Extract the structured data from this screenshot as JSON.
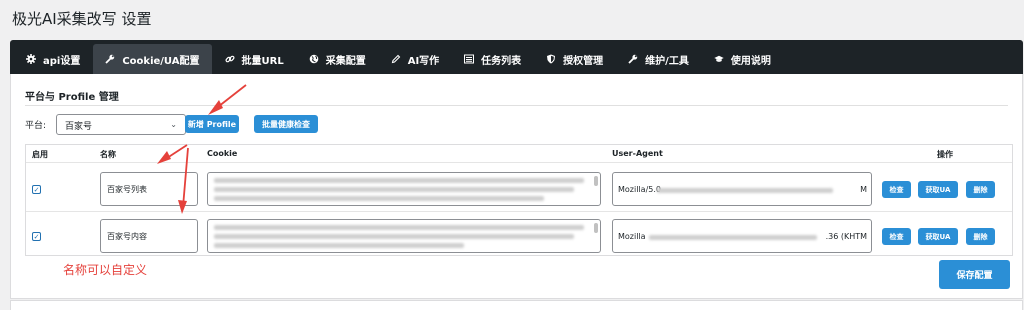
{
  "page": {
    "title": "极光AI采集改写 设置"
  },
  "tabs": [
    {
      "label": "api设置",
      "icon": "gear-icon",
      "active": false
    },
    {
      "label": "Cookie/UA配置",
      "icon": "wrench-icon",
      "active": true
    },
    {
      "label": "批量URL",
      "icon": "link-icon",
      "active": false
    },
    {
      "label": "采集配置",
      "icon": "globe-icon",
      "active": false
    },
    {
      "label": "AI写作",
      "icon": "pen-icon",
      "active": false
    },
    {
      "label": "任务列表",
      "icon": "list-icon",
      "active": false
    },
    {
      "label": "授权管理",
      "icon": "shield-icon",
      "active": false
    },
    {
      "label": "维护/工具",
      "icon": "wrench-icon",
      "active": false
    },
    {
      "label": "使用说明",
      "icon": "graduation-cap-icon",
      "active": false
    }
  ],
  "section": {
    "title": "平台与 Profile 管理",
    "platform_label": "平台:",
    "platform_value": "百家号",
    "add_profile": "新增 Profile",
    "batch_check": "批量健康检查"
  },
  "table": {
    "headers": {
      "enabled": "启用",
      "name": "名称",
      "cookie": "Cookie",
      "ua": "User-Agent",
      "actions": "操作"
    },
    "rows": [
      {
        "enabled": true,
        "name": "百家号列表",
        "ua_prefix": "Mozilla/5.0",
        "ua_suffix": "M"
      },
      {
        "enabled": true,
        "name": "百家号内容",
        "ua_prefix": "Mozilla",
        "ua_suffix": ".36 (KHTM"
      }
    ],
    "actions": {
      "check": "检查",
      "get_ua": "获取UA",
      "delete": "删除"
    }
  },
  "annotation": {
    "note": "名称可以自定义",
    "color": "#e5413b"
  },
  "footer": {
    "save": "保存配置"
  },
  "colors": {
    "tabbar": "#1d2327",
    "accent": "#2b8fd6"
  }
}
